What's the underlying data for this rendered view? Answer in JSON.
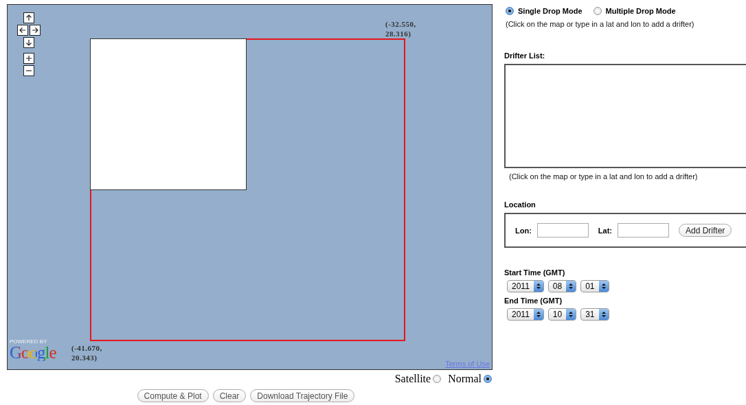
{
  "map": {
    "corner_labels": [
      {
        "lines": [
          "(-32.550,",
          "28.316)"
        ]
      },
      {
        "lines": [
          "(-41.670,",
          "20.343)"
        ]
      }
    ],
    "powered_by": "POWERED BY",
    "logo": "Google",
    "terms_link": "Terms of Use"
  },
  "map_type": [
    {
      "label": "Satellite",
      "selected": false
    },
    {
      "label": "Normal",
      "selected": true
    }
  ],
  "actions": [
    "Compute & Plot",
    "Clear",
    "Download Trajectory File"
  ],
  "drop_mode": [
    {
      "label": "Single Drop Mode",
      "selected": true
    },
    {
      "label": "Multiple Drop Mode",
      "selected": false
    }
  ],
  "drop_hint": "(Click on the map or type in a lat and lon to add a drifter)",
  "drifter_list": {
    "label": "Drifter List:",
    "hint": "(Click on the map or type in a lat and lon to add a drifter)"
  },
  "location": {
    "label": "Location",
    "fields": [
      {
        "label": "Lon:"
      },
      {
        "label": "Lat:"
      }
    ],
    "button": "Add Drifter"
  },
  "times": [
    {
      "label": "Start Time (GMT)",
      "selects": [
        "2011",
        "08",
        "01"
      ]
    },
    {
      "label": "End Time (GMT)",
      "selects": [
        "2011",
        "10",
        "31"
      ]
    }
  ]
}
